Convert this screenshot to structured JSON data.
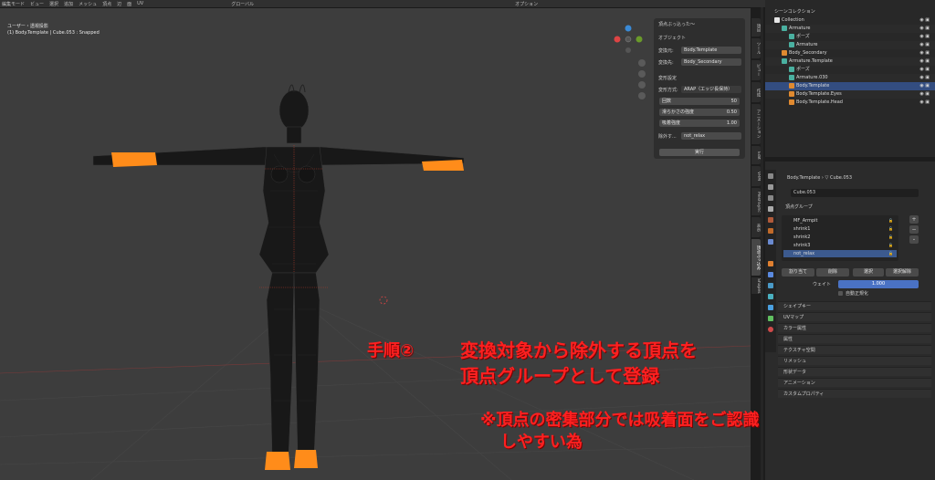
{
  "header": {
    "mode": "編集モード",
    "menus": [
      "ビュー",
      "選択",
      "追加",
      "メッシュ",
      "頂点",
      "辺",
      "面",
      "UV"
    ],
    "transform_orientation": "グローバル",
    "options_label": "オプション"
  },
  "viewport": {
    "view_name": "ユーザー・透視投影",
    "object_info": "(1) Body.Template | Cube.053 : Snapped"
  },
  "npanel": {
    "operator_title": "頂点ぶっ込った〜",
    "section_object": "オブジェクト",
    "from_label": "変換元:",
    "from_value": "Body.Template",
    "to_label": "変換先:",
    "to_value": "Body_Secondary",
    "section_deform": "変形設定",
    "deform_method_label": "変形方式:",
    "deform_method_value": "ARAP（エッジ長保持）",
    "iterations_label": "回数",
    "iterations_value": "50",
    "smooth_label": "滑らかさの強度",
    "smooth_value": "0.50",
    "adsorb_label": "吸着強度",
    "adsorb_value": "1.00",
    "exclude_label": "除外す...",
    "exclude_value": "not_relax",
    "run_label": "実行"
  },
  "tabs": [
    "項目",
    "ツール",
    "ビュー",
    "作成",
    "アニメーション",
    "Edit",
    "VRM",
    "MeshSync",
    "表示",
    "頂点ぶっ込み",
    "Shapes"
  ],
  "outliner": {
    "title": "シーンコレクション",
    "rows": [
      {
        "label": "Collection",
        "indent": 0,
        "type": "collection"
      },
      {
        "label": "Armature",
        "indent": 1,
        "type": "armature"
      },
      {
        "label": "ポーズ",
        "indent": 2,
        "type": "pose"
      },
      {
        "label": "Armature",
        "indent": 2,
        "type": "armature"
      },
      {
        "label": "Body_Secondary",
        "indent": 1,
        "type": "mesh"
      },
      {
        "label": "Armature.Template",
        "indent": 1,
        "type": "armature"
      },
      {
        "label": "ポーズ",
        "indent": 2,
        "type": "pose"
      },
      {
        "label": "Armature.030",
        "indent": 2,
        "type": "armature"
      },
      {
        "label": "Body.Template",
        "indent": 2,
        "type": "mesh",
        "selected": true
      },
      {
        "label": "Body.Template.Eyes",
        "indent": 2,
        "type": "mesh"
      },
      {
        "label": "Body.Template.Head",
        "indent": 2,
        "type": "mesh"
      }
    ]
  },
  "properties": {
    "breadcrumb_object": "Body.Template",
    "breadcrumb_mesh": "Cube.053",
    "mesh_name": "Cube.053",
    "vertex_groups_title": "頂点グループ",
    "vertex_groups": [
      {
        "name": "MF_Armpit",
        "selected": false
      },
      {
        "name": "shrink1",
        "selected": false
      },
      {
        "name": "shrink2",
        "selected": false
      },
      {
        "name": "shrink3",
        "selected": false
      },
      {
        "name": "not_relax",
        "selected": true
      }
    ],
    "assign_label": "割り当て",
    "remove_label": "削除",
    "select_label": "選択",
    "deselect_label": "選択解除",
    "weight_label": "ウェイト",
    "weight_value": "1.000",
    "normalize_label": "自動正規化",
    "sections": [
      "シェイプキー",
      "UVマップ",
      "カラー属性",
      "属性",
      "テクスチャ空間",
      "リメッシュ",
      "形状データ",
      "アニメーション",
      "カスタムプロパティ"
    ]
  },
  "annotation": {
    "step": "手順②",
    "line1": "変換対象から除外する頂点を",
    "line2": "頂点グループとして登録",
    "note1": "※頂点の密集部分では吸着面をご認識",
    "note2": "しやすい為"
  },
  "colors": {
    "selection_orange": "#ff8c1a",
    "active_blue": "#334d80",
    "annotation_red": "#ff2020"
  }
}
